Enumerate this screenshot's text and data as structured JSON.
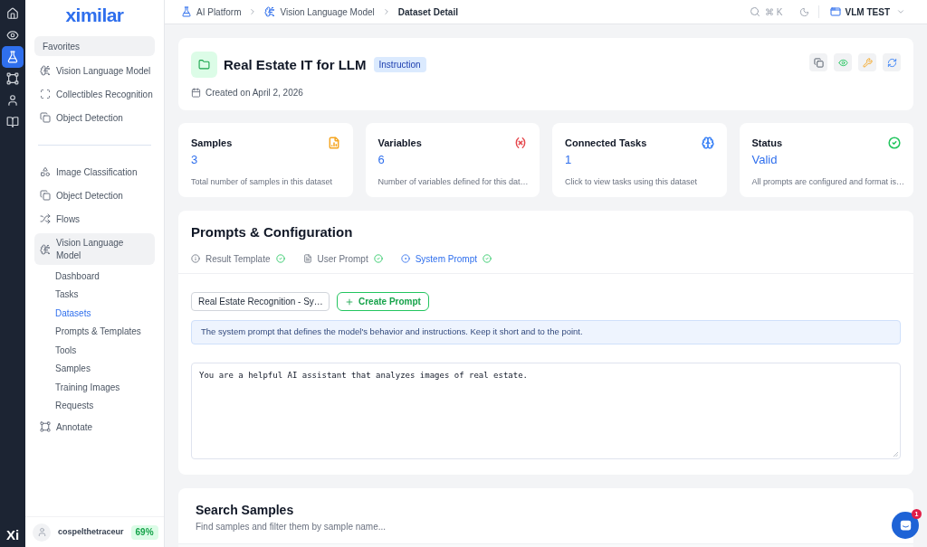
{
  "rail": {
    "items": [
      {
        "kind": "home",
        "selected": false
      },
      {
        "kind": "eye",
        "selected": false
      },
      {
        "kind": "flask",
        "selected": true
      },
      {
        "kind": "vector",
        "selected": false
      },
      {
        "kind": "user",
        "selected": false
      },
      {
        "kind": "book",
        "selected": false
      }
    ],
    "brand": "Xi"
  },
  "sidebar": {
    "logo": "ximilar",
    "favorites": {
      "title": "Favorites",
      "items": [
        {
          "label": "Vision Language Model",
          "kind": "vlm"
        },
        {
          "label": "Collectibles Recognition",
          "kind": "scan"
        },
        {
          "label": "Object Detection",
          "kind": "detect"
        }
      ]
    },
    "nav": [
      {
        "label": "Image Classification",
        "kind": "shapes",
        "selected": false
      },
      {
        "label": "Object Detection",
        "kind": "detect",
        "selected": false
      },
      {
        "label": "Flows",
        "kind": "flows",
        "selected": false
      },
      {
        "label": "Vision Language Model",
        "kind": "vlm",
        "selected": true,
        "children": [
          {
            "label": "Dashboard",
            "selected": false
          },
          {
            "label": "Tasks",
            "selected": false
          },
          {
            "label": "Datasets",
            "selected": true
          },
          {
            "label": "Prompts & Templates",
            "selected": false
          },
          {
            "label": "Tools",
            "selected": false
          },
          {
            "label": "Samples",
            "selected": false
          },
          {
            "label": "Training Images",
            "selected": false
          },
          {
            "label": "Requests",
            "selected": false
          }
        ]
      },
      {
        "label": "Annotate",
        "kind": "vector",
        "selected": false
      }
    ],
    "user": {
      "name": "cospelthetraceur",
      "usage": "69%"
    }
  },
  "topbar": {
    "breadcrumb": [
      {
        "label": "AI Platform",
        "kind": "flask"
      },
      {
        "label": "Vision Language Model",
        "kind": "vlm"
      },
      {
        "label": "Dataset Detail",
        "kind": "current"
      }
    ],
    "shortcut": "⌘ K",
    "workspace": "VLM TEST"
  },
  "dataset": {
    "title": "Real Estate IT for LLM",
    "badge": "Instruction",
    "created": "Created on April 2, 2026",
    "actions": [
      {
        "kind": "copy"
      },
      {
        "kind": "view"
      },
      {
        "kind": "edit"
      },
      {
        "kind": "refresh"
      }
    ]
  },
  "stats": [
    {
      "title": "Samples",
      "value": "3",
      "description": "Total number of samples in this dataset",
      "kind": "file",
      "color": "#f5a623"
    },
    {
      "title": "Variables",
      "value": "6",
      "description": "Number of variables defined for this dat…",
      "kind": "variable",
      "color": "#e5484d"
    },
    {
      "title": "Connected Tasks",
      "value": "1",
      "description": "Click to view tasks using this dataset",
      "kind": "brain",
      "color": "#3b82f6"
    },
    {
      "title": "Status",
      "value": "Valid",
      "description": "All prompts are configured and format is…",
      "kind": "check",
      "color": "#22c55e"
    }
  ],
  "prompts": {
    "title": "Prompts & Configuration",
    "tabs": [
      {
        "label": "Result Template",
        "kind": "info",
        "selected": false,
        "valid": true
      },
      {
        "label": "User Prompt",
        "kind": "file",
        "selected": false,
        "valid": true
      },
      {
        "label": "System Prompt",
        "kind": "system",
        "selected": true,
        "valid": true
      }
    ],
    "select": {
      "value": "Real Estate Recognition - Sy…"
    },
    "create_button": "Create Prompt",
    "info": "The system prompt that defines the model's behavior and instructions. Keep it short and to the point.",
    "editor": {
      "value": "You are a helpful AI assistant that analyzes images of real estate."
    }
  },
  "search_samples": {
    "title": "Search Samples",
    "subtitle": "Find samples and filter them by sample name..."
  },
  "chat": {
    "badge": "1"
  }
}
